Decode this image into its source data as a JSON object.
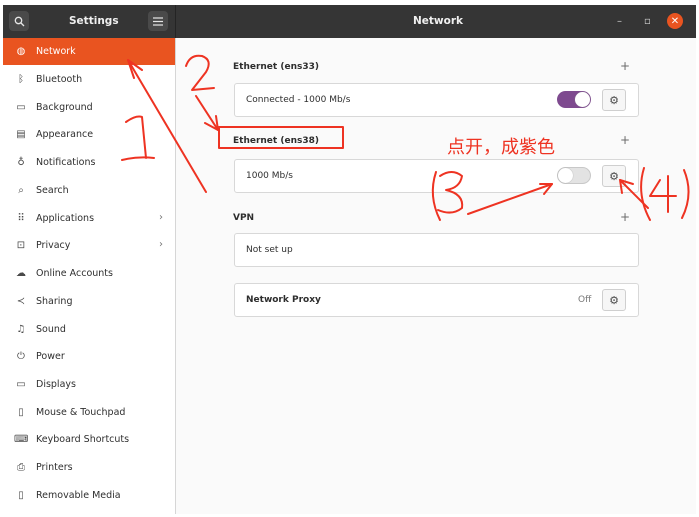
{
  "header": {
    "sidebar_title": "Settings",
    "page_title": "Network",
    "min_glyph": "–",
    "max_glyph": "▫",
    "close_glyph": "✕"
  },
  "sidebar": {
    "items": [
      {
        "label": "Network",
        "icon": "network-icon"
      },
      {
        "label": "Bluetooth",
        "icon": "bluetooth-icon"
      },
      {
        "label": "Background",
        "icon": "background-icon"
      },
      {
        "label": "Appearance",
        "icon": "appearance-icon"
      },
      {
        "label": "Notifications",
        "icon": "bell-icon"
      },
      {
        "label": "Search",
        "icon": "search-icon"
      },
      {
        "label": "Applications",
        "icon": "grid-icon"
      },
      {
        "label": "Privacy",
        "icon": "lock-icon"
      },
      {
        "label": "Online Accounts",
        "icon": "cloud-icon"
      },
      {
        "label": "Sharing",
        "icon": "share-icon"
      },
      {
        "label": "Sound",
        "icon": "music-icon"
      },
      {
        "label": "Power",
        "icon": "power-icon"
      },
      {
        "label": "Displays",
        "icon": "display-icon"
      },
      {
        "label": "Mouse & Touchpad",
        "icon": "mouse-icon"
      },
      {
        "label": "Keyboard Shortcuts",
        "icon": "keyboard-icon"
      },
      {
        "label": "Printers",
        "icon": "printer-icon"
      },
      {
        "label": "Removable Media",
        "icon": "media-icon"
      }
    ]
  },
  "main": {
    "ethernet1": {
      "title": "Ethernet (ens33)",
      "status": "Connected - 1000 Mb/s",
      "enabled": true
    },
    "ethernet2": {
      "title": "Ethernet (ens38)",
      "status": "1000 Mb/s",
      "enabled": false
    },
    "vpn": {
      "title": "VPN",
      "status": "Not set up"
    },
    "proxy": {
      "label": "Network Proxy",
      "status": "Off"
    },
    "plus_glyph": "+",
    "gear_glyph": "⚙"
  },
  "annotations": {
    "note": "点开，成紫色",
    "color": "#ee3322"
  },
  "colors": {
    "accent": "#e95420",
    "toggle_on": "#7e4a8f",
    "header": "#353535"
  }
}
